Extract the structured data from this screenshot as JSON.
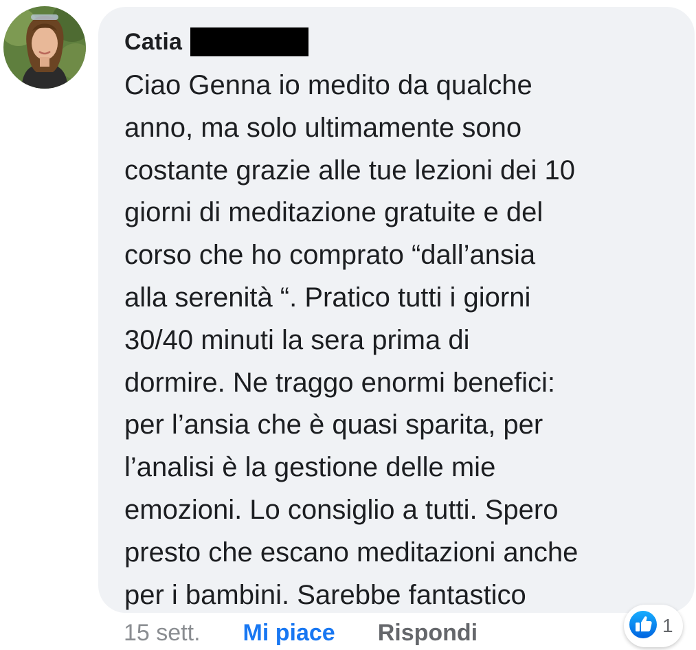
{
  "comment": {
    "author": "Catia",
    "text": "Ciao Genna io medito da qualche\nanno, ma solo ultimamente sono\ncostante grazie alle tue lezioni dei 10\ngiorni di meditazione gratuite e del\ncorso che ho comprato “dall’ansia\nalla serenità “. Pratico tutti i giorni\n30/40 minuti la sera prima di\ndormire. Ne traggo enormi benefici:\nper l’ansia che è quasi sparita, per\nl’analisi è la gestione delle mie\nemozioni. Lo consiglio a tutti. Spero\npresto che escano meditazioni anche\nper i bambini. Sarebbe fantastico",
    "timestamp": "15 sett.",
    "like_label": "Mi piace",
    "reply_label": "Rispondi",
    "reaction_count": "1",
    "reaction_icon": "like-thumb-icon"
  },
  "colors": {
    "bubble_bg": "#f0f2f5",
    "text": "#1c1e21",
    "like_blue": "#1877f2",
    "muted": "#65676b"
  }
}
